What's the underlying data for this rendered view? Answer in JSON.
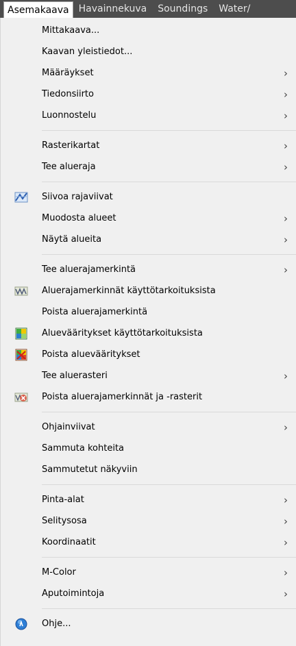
{
  "menubar": {
    "items": [
      "Asemakaava",
      "Havainnekuva",
      "Soundings",
      "Water/"
    ]
  },
  "menu": {
    "items": [
      {
        "label": "Mittakaava..."
      },
      {
        "label": "Kaavan yleistiedot..."
      },
      {
        "label": "Määräykset",
        "submenu": "›"
      },
      {
        "label": "Tiedonsiirto",
        "submenu": "›"
      },
      {
        "label": "Luonnostelu",
        "submenu": "›"
      },
      {
        "label": "Rasterikartat",
        "submenu": "›"
      },
      {
        "label": "Tee alueraja",
        "submenu": "›"
      },
      {
        "label": "Siivoa rajaviivat",
        "icon": "blue-lines-icon"
      },
      {
        "label": "Muodosta alueet",
        "submenu": "›"
      },
      {
        "label": "Näytä alueita",
        "submenu": "›"
      },
      {
        "label": "Tee aluerajamerkintä",
        "submenu": "›"
      },
      {
        "label": "Aluerajamerkinnät käyttötarkoituksista",
        "icon": "boundary-marking-icon"
      },
      {
        "label": "Poista aluerajamerkintä"
      },
      {
        "label": "Aluevääritykset käyttötarkoituksista",
        "icon": "area-coloring-icon"
      },
      {
        "label": "Poista aluevääritykset",
        "icon": "remove-coloring-icon"
      },
      {
        "label": "Tee aluerasteri",
        "submenu": "›"
      },
      {
        "label": "Poista aluerajamerkinnät ja -rasterit",
        "icon": "remove-markings-icon"
      },
      {
        "label": "Ohjainviivat",
        "submenu": "›"
      },
      {
        "label": "Sammuta kohteita"
      },
      {
        "label": "Sammutetut näkyviin"
      },
      {
        "label": "Pinta-alat",
        "submenu": "›"
      },
      {
        "label": "Selitysosa",
        "submenu": "›"
      },
      {
        "label": "Koordinaatit",
        "submenu": "›"
      },
      {
        "label": "M-Color",
        "submenu": "›"
      },
      {
        "label": "Aputoimintoja",
        "submenu": "›"
      },
      {
        "label": "Ohje...",
        "icon": "help-icon"
      }
    ]
  },
  "colors": {
    "menubar_bg": "#4d4d4d",
    "menu_bg": "#f0f0f0",
    "separator": "#d9d9d9"
  }
}
